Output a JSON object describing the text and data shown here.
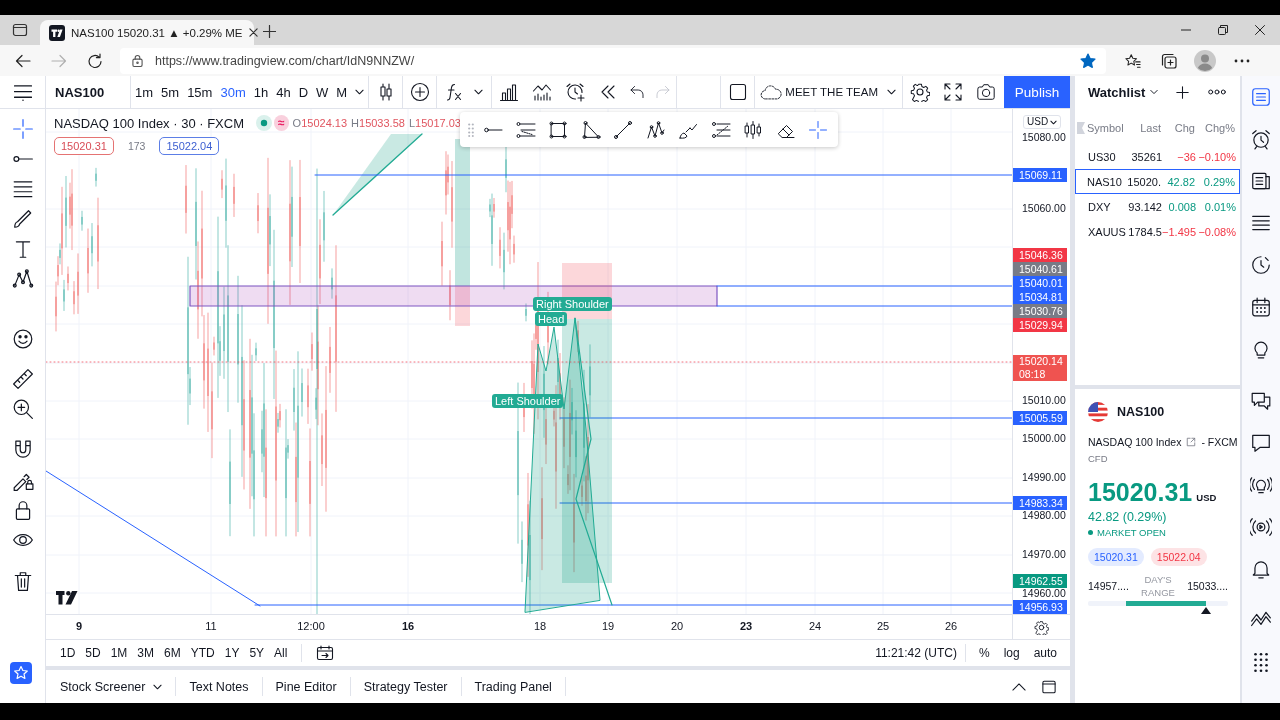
{
  "browser": {
    "tab": {
      "title": "NAS100 15020.31 ▲ +0.29% ME"
    },
    "url": "https://www.tradingview.com/chart/IdN9NNZW/",
    "favorite": true
  },
  "toolbar": {
    "symbol": "NAS100",
    "intervals": [
      {
        "label": "1m",
        "selected": false
      },
      {
        "label": "5m",
        "selected": false
      },
      {
        "label": "15m",
        "selected": false
      },
      {
        "label": "30m",
        "selected": true
      },
      {
        "label": "1h",
        "selected": false
      },
      {
        "label": "4h",
        "selected": false
      },
      {
        "label": "D",
        "selected": false
      },
      {
        "label": "W",
        "selected": false
      },
      {
        "label": "M",
        "selected": false
      }
    ],
    "layout": "MEET THE TEAM",
    "publish": "Publish"
  },
  "left_tools": [
    {
      "kind": "crosshair",
      "selected": true
    },
    {
      "kind": "trend-line",
      "selected": false
    },
    {
      "kind": "fib",
      "selected": false
    },
    {
      "kind": "brush",
      "selected": false
    },
    {
      "kind": "text",
      "selected": false
    },
    {
      "kind": "pattern",
      "selected": false
    },
    {
      "kind": "emoji",
      "selected": false
    },
    {
      "kind": "ruler",
      "selected": false
    },
    {
      "kind": "zoom",
      "selected": false
    },
    {
      "kind": "magnet",
      "selected": false
    },
    {
      "kind": "lock-drawing",
      "selected": false
    },
    {
      "kind": "lock",
      "selected": false
    },
    {
      "kind": "eye",
      "selected": false
    },
    {
      "kind": "trash",
      "selected": false
    }
  ],
  "legend": {
    "title": "NASDAQ 100 Index · 30 · FXCM",
    "market_open": true,
    "badge": "≈",
    "ohlc": [
      {
        "key": "O",
        "value": "15024.13"
      },
      {
        "key": "H",
        "value": "15033.58"
      },
      {
        "key": "L",
        "value": "15017.03"
      }
    ],
    "sell": "15020.31",
    "spread": "173",
    "buy": "15022.04"
  },
  "drawing_toolbar": [
    {
      "kind": "hline",
      "selected": false
    },
    {
      "kind": "parallel",
      "selected": false
    },
    {
      "kind": "rectangle",
      "selected": false
    },
    {
      "kind": "triangle",
      "selected": false
    },
    {
      "kind": "line",
      "selected": false
    },
    {
      "kind": "xabcd",
      "selected": false
    },
    {
      "kind": "brush-check",
      "selected": false
    },
    {
      "kind": "fib-lines",
      "selected": false
    },
    {
      "kind": "candles",
      "selected": false
    },
    {
      "kind": "eraser",
      "selected": false
    },
    {
      "kind": "crosshair",
      "selected": true
    }
  ],
  "chart": {
    "labels": [
      "Right Shoulder",
      "Head",
      "Left Shoulder"
    ]
  },
  "price_axis": {
    "currency": "USD",
    "ticks": [
      "15080.00",
      "15060.00",
      "15010.00",
      "15000.00",
      "14990.00",
      "14980.00",
      "14970.00",
      "14960.00"
    ],
    "tags": [
      {
        "text": "15069.11",
        "color": "#2962ff"
      },
      {
        "text": "15046.36",
        "color": "#f23645"
      },
      {
        "text": "15040.61",
        "color": "#787b86"
      },
      {
        "text": "15040.01",
        "color": "#2962ff"
      },
      {
        "text": "15034.81",
        "color": "#2962ff"
      },
      {
        "text": "15030.76",
        "color": "#787b86"
      },
      {
        "text": "15029.94",
        "color": "#f23645"
      },
      {
        "text": "15020.14",
        "countdown": "08:18",
        "color": "#ef5350"
      },
      {
        "text": "15005.59",
        "color": "#2962ff"
      },
      {
        "text": "14983.34",
        "color": "#2962ff"
      },
      {
        "text": "14962.55",
        "color": "#089981"
      },
      {
        "text": "14956.93",
        "color": "#2962ff"
      }
    ]
  },
  "time_axis": [
    {
      "label": "9",
      "major": true
    },
    {
      "label": "11",
      "major": false
    },
    {
      "label": "12:00",
      "major": false
    },
    {
      "label": "16",
      "major": true
    },
    {
      "label": "18",
      "major": false
    },
    {
      "label": "19",
      "major": false
    },
    {
      "label": "20",
      "major": false
    },
    {
      "label": "23",
      "major": true
    },
    {
      "label": "24",
      "major": false
    },
    {
      "label": "25",
      "major": false
    },
    {
      "label": "26",
      "major": false
    }
  ],
  "range_bar": {
    "ranges": [
      "1D",
      "5D",
      "1M",
      "3M",
      "6M",
      "YTD",
      "1Y",
      "5Y",
      "All"
    ],
    "clock": "11:21:42 (UTC)",
    "options": [
      "%",
      "log",
      "auto"
    ]
  },
  "bottom_panel": {
    "tabs": [
      {
        "label": "Stock Screener",
        "dropdown": true
      },
      {
        "label": "Text Notes",
        "dropdown": false
      },
      {
        "label": "Pine Editor",
        "dropdown": false
      },
      {
        "label": "Strategy Tester",
        "dropdown": false
      },
      {
        "label": "Trading Panel",
        "dropdown": false
      }
    ]
  },
  "watchlist": {
    "title": "Watchlist",
    "columns": [
      "Symbol",
      "Last",
      "Chg",
      "Chg%"
    ],
    "rows": [
      {
        "symbol": "US30",
        "last": "35261",
        "chg": "−36",
        "chg_pct": "−0.10%",
        "down": true,
        "selected": false
      },
      {
        "symbol": "NAS10",
        "last": "15020.",
        "chg": "42.82",
        "chg_pct": "0.29%",
        "down": false,
        "selected": true
      },
      {
        "symbol": "DXY",
        "last": "93.142",
        "chg": "0.008",
        "chg_pct": "0.01%",
        "down": false,
        "selected": false
      },
      {
        "symbol": "XAUUS",
        "last": "1784.5",
        "chg": "−1.495",
        "chg_pct": "−0.08%",
        "down": true,
        "selected": false
      }
    ]
  },
  "details": {
    "symbol": "NAS100",
    "name": "NASDAQ 100 Index",
    "exchange": "- FXCM",
    "type": "CFD",
    "price": "15020.31",
    "currency": "USD",
    "change": "42.82 (0.29%)",
    "down": false,
    "market_open": true,
    "status": "MARKET OPEN",
    "bid": "15020.31",
    "ask": "15022.04",
    "low": "14957....",
    "range_label": "DAY'S RANGE",
    "high": "15033....",
    "range": {
      "level": 0.84
    }
  },
  "right_bar": [
    {
      "kind": "watchlist",
      "selected": true
    },
    {
      "kind": "alerts",
      "selected": false
    },
    {
      "kind": "data-window",
      "selected": false
    },
    {
      "kind": "news",
      "selected": false
    },
    {
      "kind": "clock",
      "selected": false
    },
    {
      "kind": "calendar",
      "selected": false
    },
    {
      "kind": "ideas",
      "selected": false
    },
    {
      "kind": "chats",
      "selected": false
    },
    {
      "kind": "chat",
      "selected": false
    },
    {
      "kind": "streams",
      "selected": false
    },
    {
      "kind": "broadcast",
      "selected": false
    },
    {
      "kind": "notifications",
      "selected": false
    },
    {
      "kind": "patterns",
      "selected": false
    },
    {
      "kind": "grid",
      "selected": false
    }
  ]
}
